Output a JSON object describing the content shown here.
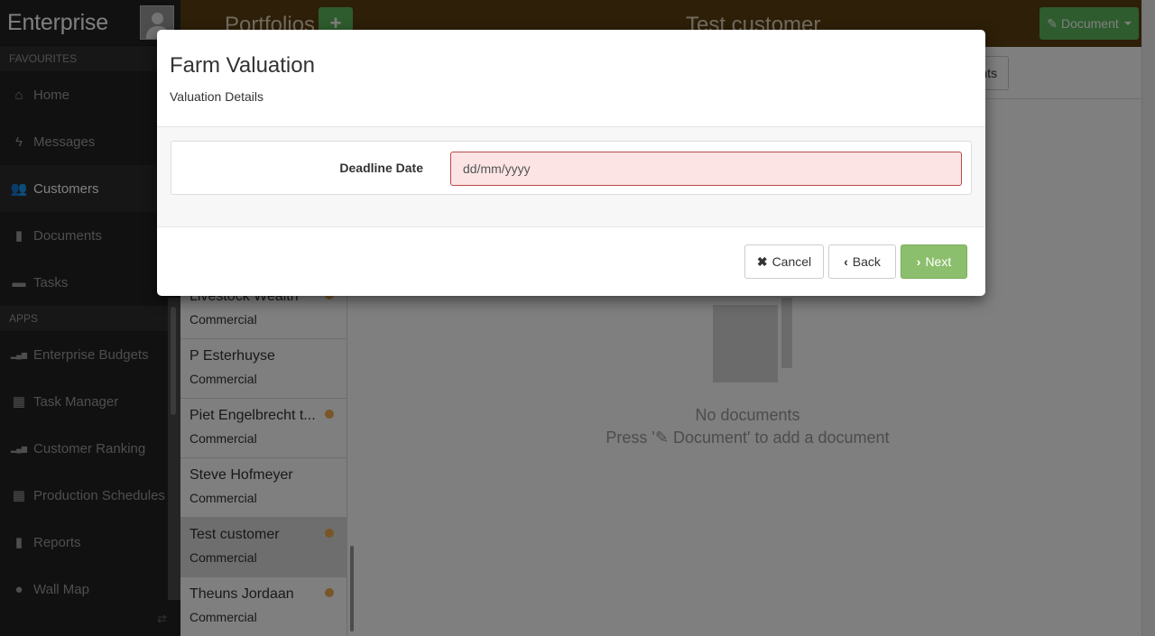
{
  "sidebar": {
    "brand": "Enterprise",
    "favourites_heading": "FAVOURITES",
    "apps_heading": "APPS",
    "favourites": [
      {
        "label": "Home",
        "icon": "home-icon"
      },
      {
        "label": "Messages",
        "icon": "flash-icon"
      },
      {
        "label": "Customers",
        "icon": "users-icon"
      },
      {
        "label": "Documents",
        "icon": "documents-icon"
      },
      {
        "label": "Tasks",
        "icon": "briefcase-icon"
      }
    ],
    "apps": [
      {
        "label": "Enterprise Budgets",
        "icon": "bar-chart-icon"
      },
      {
        "label": "Task Manager",
        "icon": "calendar-icon"
      },
      {
        "label": "Customer Ranking",
        "icon": "bar-chart-icon"
      },
      {
        "label": "Production Schedules",
        "icon": "calendar-icon"
      },
      {
        "label": "Reports",
        "icon": "documents-icon"
      },
      {
        "label": "Wall Map",
        "icon": "globe-icon"
      }
    ],
    "active": "Customers"
  },
  "topbar": {
    "left_title": "Portfolios",
    "center_title": "Test customer",
    "document_button": "Document",
    "brand_color": "#5a3f10",
    "accent_green": "#5cb85c"
  },
  "customers": [
    {
      "name": "Livestock Wealth",
      "type": "Commercial",
      "dot": true
    },
    {
      "name": "P Esterhuyse",
      "type": "Commercial",
      "dot": false
    },
    {
      "name": "Piet Engelbrecht t...",
      "type": "Commercial",
      "dot": true
    },
    {
      "name": "Steve Hofmeyer",
      "type": "Commercial",
      "dot": false
    },
    {
      "name": "Test customer",
      "type": "Commercial",
      "dot": true
    },
    {
      "name": "Theuns Jordaan",
      "type": "Commercial",
      "dot": true
    }
  ],
  "main": {
    "toolbar_button": "nts",
    "empty_title": "No documents",
    "empty_hint_prefix": "Press '",
    "empty_hint_suffix": " Document' to add a document"
  },
  "modal": {
    "title": "Farm Valuation",
    "subtitle": "Valuation Details",
    "field_label": "Deadline Date",
    "field_placeholder": "dd/mm/yyyy",
    "field_value": "",
    "cancel_label": "Cancel",
    "back_label": "Back",
    "next_label": "Next"
  }
}
